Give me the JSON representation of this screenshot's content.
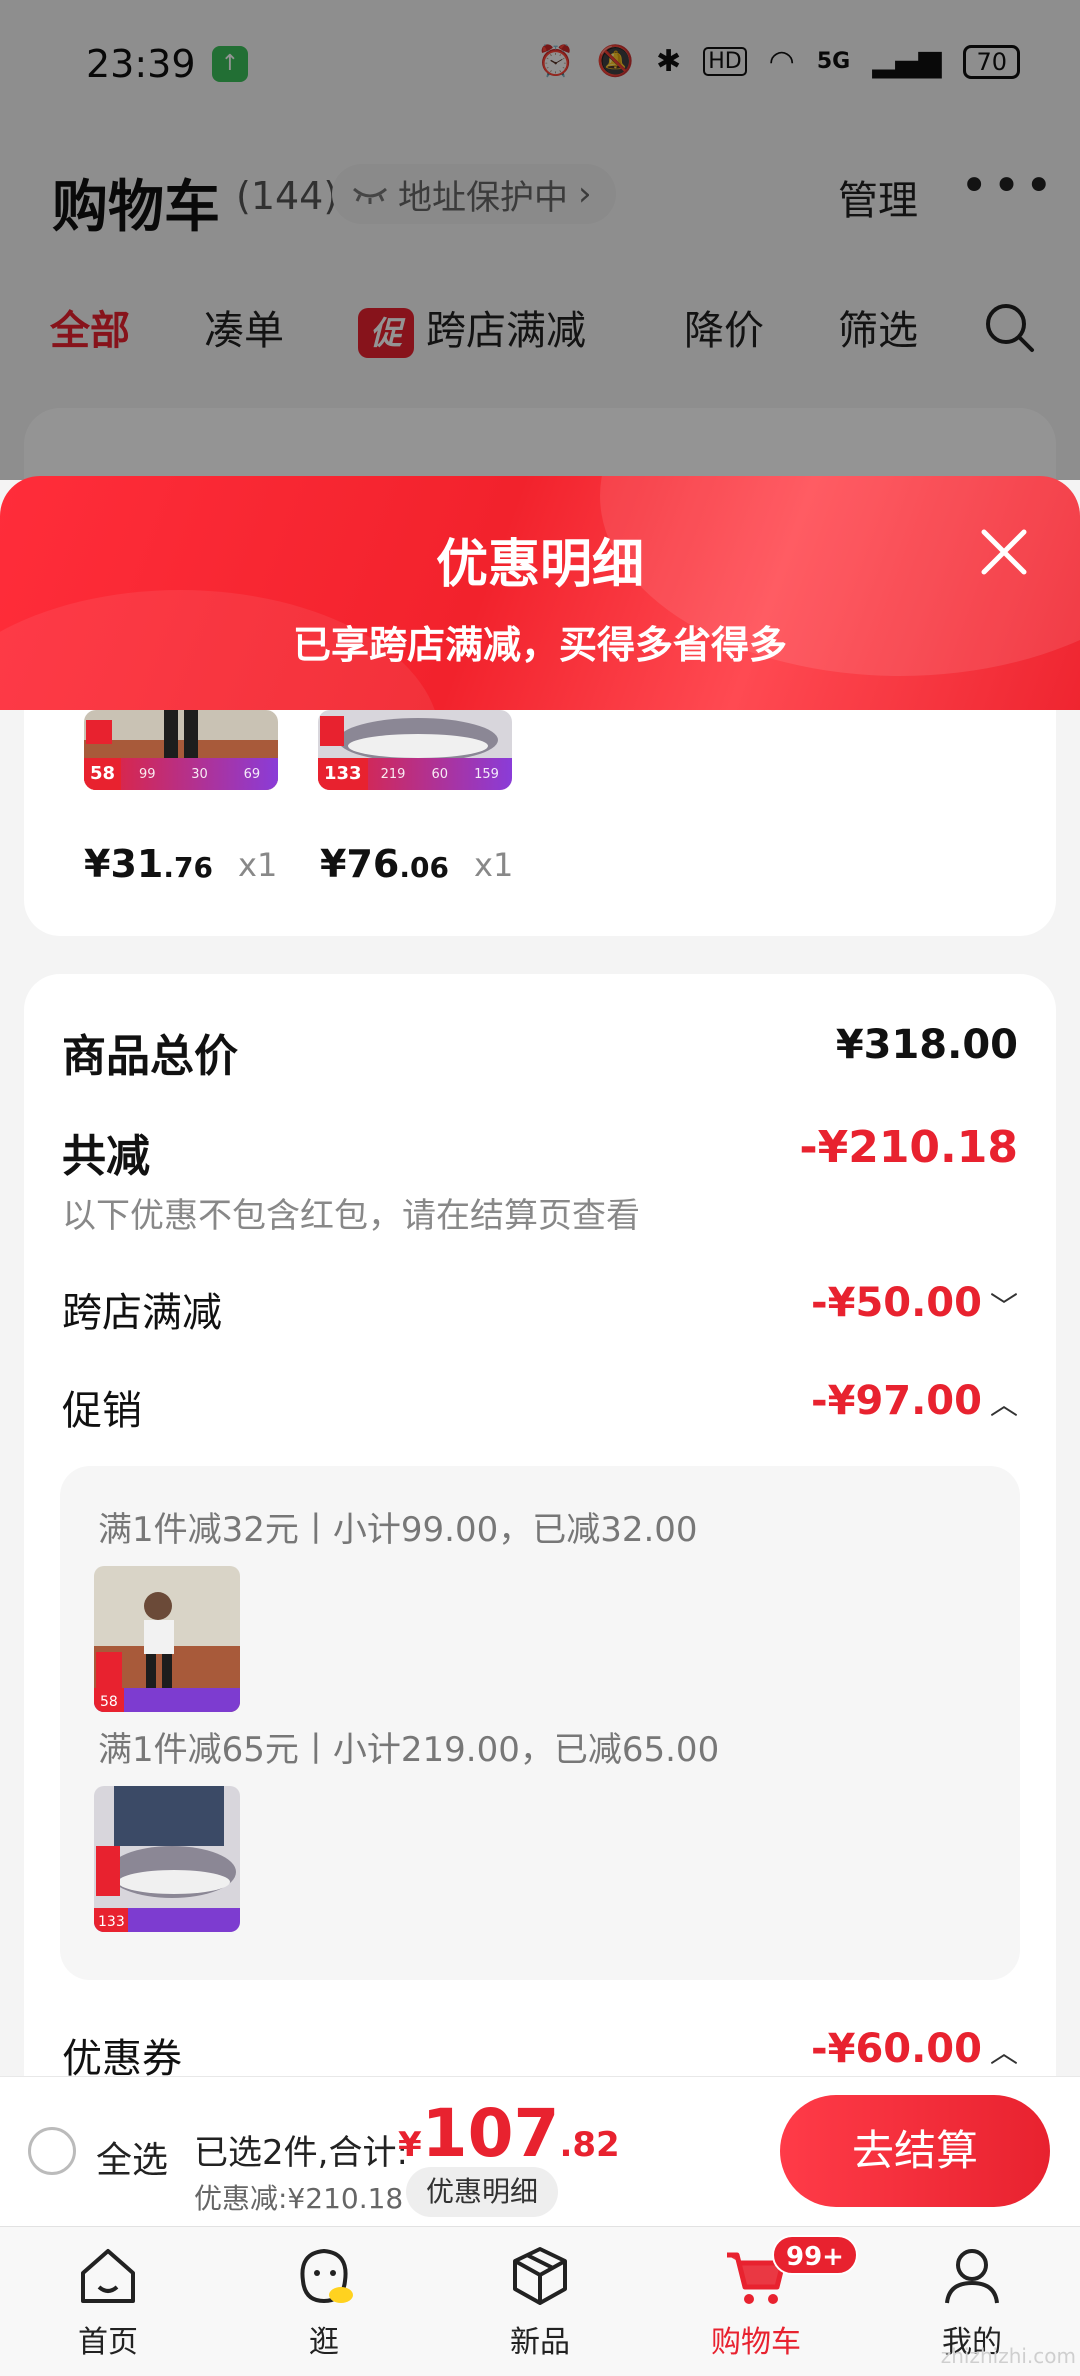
{
  "status_bar": {
    "time": "23:39",
    "battery": "70",
    "network": "5G",
    "hd": "HD"
  },
  "header": {
    "title": "购物车",
    "count": "(144)",
    "address_protect": "地址保护中",
    "manage": "管理",
    "more": "•••"
  },
  "filter_tabs": [
    "全部",
    "凑单",
    "跨店满减",
    "降价",
    "筛选"
  ],
  "promo_badge": "促",
  "sheet": {
    "title": "优惠明细",
    "subtitle": "已享跨店满减，买得多省得多"
  },
  "items": [
    {
      "price_int": "¥31",
      "price_dec": ".76",
      "qty": "x1",
      "tag_price": "58",
      "tag_cols": [
        "99",
        "30",
        "69"
      ]
    },
    {
      "price_int": "¥76",
      "price_dec": ".06",
      "qty": "x1",
      "tag_price": "133",
      "tag_cols": [
        "219",
        "60",
        "159"
      ]
    }
  ],
  "details": {
    "subtotal_label": "商品总价",
    "subtotal_value": "¥318.00",
    "total_discount_label": "共减",
    "total_discount_value": "-¥210.18",
    "note": "以下优惠不包含红包，请在结算页查看",
    "cross_store_label": "跨店满减",
    "cross_store_value": "-¥50.00",
    "promo_label": "促销",
    "promo_value": "-¥97.00",
    "promo_lines": [
      "满1件减32元丨小计99.00，已减32.00",
      "满1件减65元丨小计219.00，已减65.00"
    ],
    "coupon_label": "优惠券",
    "coupon_value": "-¥60.00"
  },
  "checkout": {
    "select_all": "全选",
    "selected": "已选2件,合计:",
    "currency": "¥",
    "total_int": "107",
    "total_dec": ".82",
    "discount": "优惠减:¥210.18",
    "detail_button": "优惠明细",
    "checkout_button": "去结算"
  },
  "tab_bar": {
    "items": [
      "首页",
      "逛",
      "新品",
      "购物车",
      "我的"
    ],
    "cart_badge": "99+"
  },
  "watermark": "zhizhizhi.com",
  "colors": {
    "accent": "#e8222f",
    "sheet_gradient": "#ff2d3a"
  },
  "icons": [
    "app-notify-icon",
    "alarm-icon",
    "mute-icon",
    "bluetooth-icon",
    "wifi-icon",
    "signal-icon",
    "eye-closed-icon",
    "chevron-right-icon",
    "search-icon",
    "close-icon",
    "chevron-down-icon",
    "chevron-up-icon",
    "home-icon",
    "browse-icon",
    "new-box-icon",
    "cart-icon",
    "user-icon"
  ]
}
